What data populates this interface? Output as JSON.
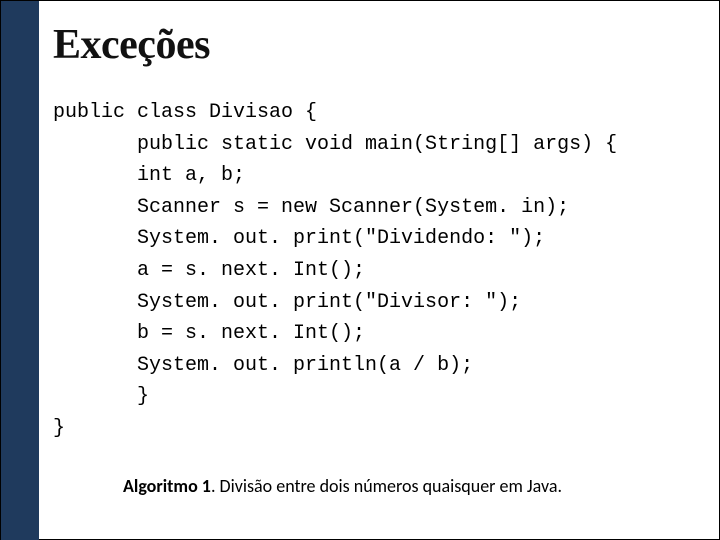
{
  "title": "Exceções",
  "code": {
    "l1": "public class Divisao {",
    "l2": "       public static void main(String[] args) {",
    "l3": "       int a, b;",
    "l4": "       Scanner s = new Scanner(System. in);",
    "l5": "       System. out. print(\"Dividendo: \");",
    "l6": "       a = s. next. Int();",
    "l7": "       System. out. print(\"Divisor: \");",
    "l8": "       b = s. next. Int();",
    "l9": "       System. out. println(a / b);",
    "l10": "       }",
    "l11": "}"
  },
  "caption_bold": "Algoritmo 1",
  "caption_rest": ". Divisão entre  dois números quaisquer em Java."
}
